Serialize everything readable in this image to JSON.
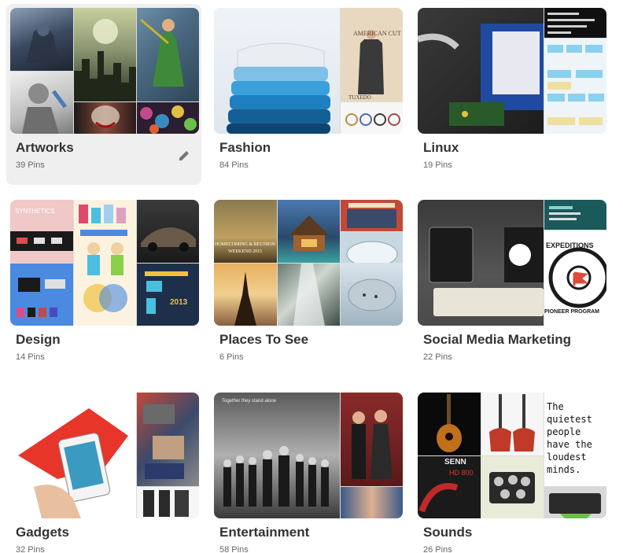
{
  "boards": [
    {
      "title": "Artworks",
      "count": "39 Pins"
    },
    {
      "title": "Fashion",
      "count": "84 Pins"
    },
    {
      "title": "Linux",
      "count": "19 Pins"
    },
    {
      "title": "Design",
      "count": "14 Pins"
    },
    {
      "title": "Places To See",
      "count": "6 Pins"
    },
    {
      "title": "Social Media Marketing",
      "count": "22 Pins"
    },
    {
      "title": "Gadgets",
      "count": "32 Pins"
    },
    {
      "title": "Entertainment",
      "count": "58 Pins"
    },
    {
      "title": "Sounds",
      "count": "26 Pins"
    }
  ],
  "image_text": {
    "american_cut": "AMERICAN CUT",
    "tuxedo": "TUXEDO",
    "synthetics": "SYNTHETICS",
    "homecoming": "HOMECOMING & REUNION",
    "weekend": "WEEKEND 2015",
    "expeditions": "EXPEDITIONS",
    "pioneer": "PIONEER PROGRAM",
    "year_2013": "2013",
    "together": "Together they stand alone",
    "quote": "The quietest people have the loudest minds.",
    "senn": "SENN",
    "hd800": "HD 800"
  },
  "colors": {
    "hover_bg": "#efefef",
    "title": "#333333",
    "count": "#666666"
  }
}
